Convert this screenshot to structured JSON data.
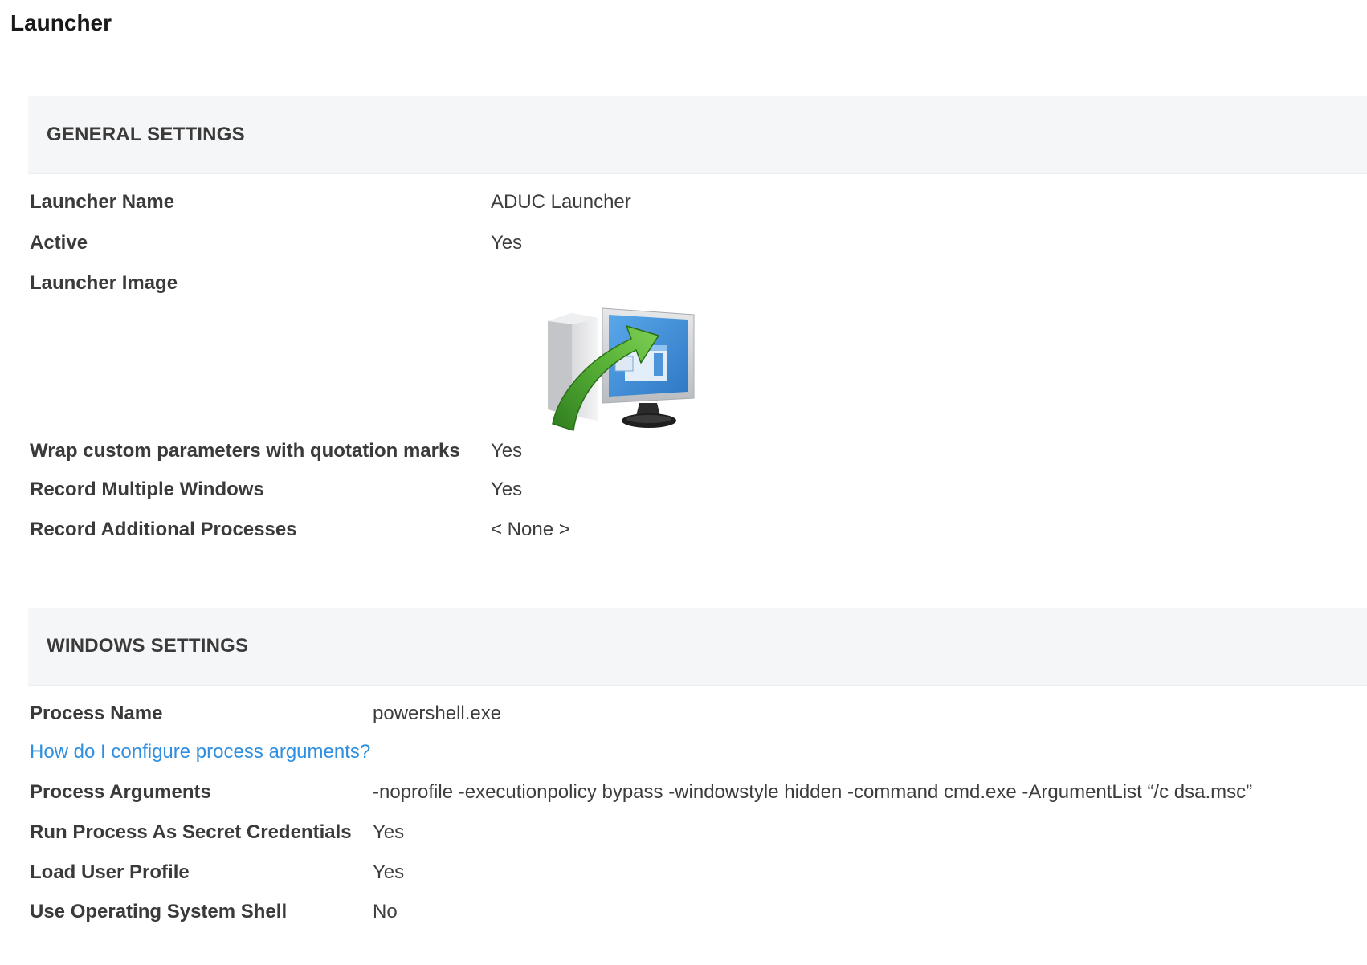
{
  "page": {
    "title": "Launcher"
  },
  "general_settings": {
    "header": "GENERAL SETTINGS",
    "rows": [
      {
        "label": "Launcher Name",
        "value": "ADUC Launcher"
      },
      {
        "label": "Active",
        "value": "Yes"
      },
      {
        "label": "Launcher Image",
        "value": ""
      },
      {
        "label": "Wrap custom parameters with quotation marks",
        "value": "Yes"
      },
      {
        "label": "Record Multiple Windows",
        "value": "Yes"
      },
      {
        "label": "Record Additional Processes",
        "value": "< None >"
      }
    ],
    "launcher_image_icon": "monitor-arrow-launcher-icon"
  },
  "windows_settings": {
    "header": "WINDOWS SETTINGS",
    "help_link": "How do I configure process arguments?",
    "rows": [
      {
        "label": "Process Name",
        "value": "powershell.exe"
      },
      {
        "label": "Process Arguments",
        "value": "-noprofile -executionpolicy bypass -windowstyle hidden -command cmd.exe -ArgumentList “/c dsa.msc”"
      },
      {
        "label": "Run Process As Secret Credentials",
        "value": "Yes"
      },
      {
        "label": "Load User Profile",
        "value": "Yes"
      },
      {
        "label": "Use Operating System Shell",
        "value": "No"
      }
    ]
  },
  "colors": {
    "link": "#2f8fe0",
    "section_bg": "#f5f6f7",
    "arrow_green": "#4aa02c",
    "screen_blue": "#3d8fd6"
  }
}
